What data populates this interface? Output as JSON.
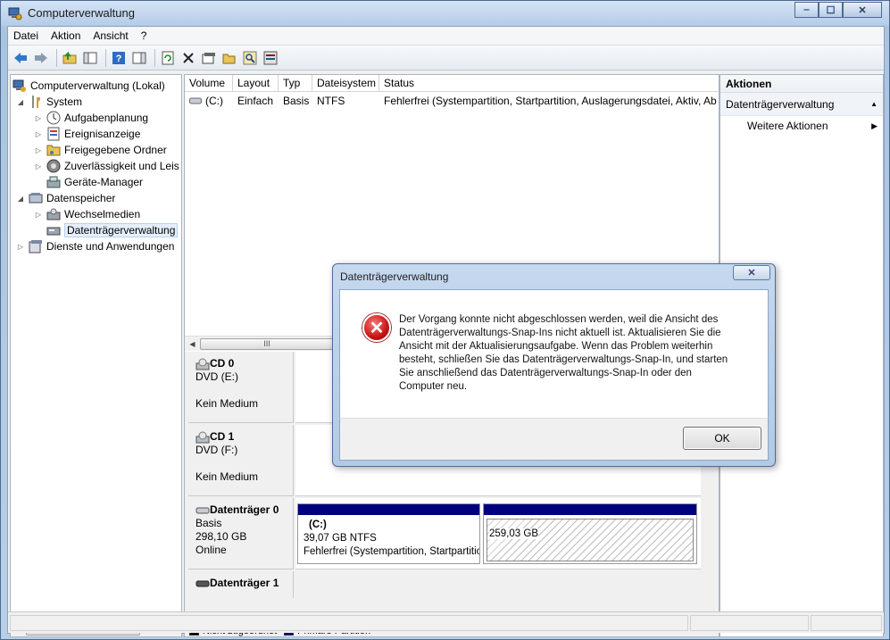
{
  "window": {
    "title": "Computerverwaltung",
    "minimize": "‒",
    "maximize": "☐",
    "close": "✕"
  },
  "menu": [
    "Datei",
    "Aktion",
    "Ansicht",
    "?"
  ],
  "toolbar": {
    "icons": [
      "back-icon",
      "forward-icon",
      "up-folder-icon",
      "show-tree-icon",
      "help-icon",
      "show-actions-icon",
      "refresh-icon",
      "delete-icon",
      "properties-icon",
      "open-icon",
      "search-icon",
      "settings-icon"
    ]
  },
  "tree": {
    "root": "Computerverwaltung (Lokal)",
    "items": [
      {
        "label": "System",
        "level": 1,
        "expander": "◢"
      },
      {
        "label": "Aufgabenplanung",
        "level": 2,
        "expander": "▷"
      },
      {
        "label": "Ereignisanzeige",
        "level": 2,
        "expander": "▷"
      },
      {
        "label": "Freigegebene Ordner",
        "level": 2,
        "expander": "▷"
      },
      {
        "label": "Zuverlässigkeit und Leis",
        "level": 2,
        "expander": "▷"
      },
      {
        "label": "Geräte-Manager",
        "level": 2,
        "expander": ""
      },
      {
        "label": "Datenspeicher",
        "level": 1,
        "expander": "◢"
      },
      {
        "label": "Wechselmedien",
        "level": 2,
        "expander": "▷"
      },
      {
        "label": "Datenträgerverwaltung",
        "level": 2,
        "expander": ""
      },
      {
        "label": "Dienste und Anwendungen",
        "level": 1,
        "expander": "▷"
      }
    ],
    "scroll_thumb": "III"
  },
  "volumes": {
    "headers": [
      "Volume",
      "Layout",
      "Typ",
      "Dateisystem",
      "Status"
    ],
    "rows": [
      [
        "(C:)",
        "Einfach",
        "Basis",
        "NTFS",
        "Fehlerfrei (Systempartition, Startpartition, Auslagerungsdatei, Aktiv, Ab"
      ]
    ],
    "scroll_thumb": "III"
  },
  "disks": [
    {
      "name": "CD 0",
      "type": "DVD (E:)",
      "line3": "",
      "status": "Kein Medium"
    },
    {
      "name": "CD 1",
      "type": "DVD (F:)",
      "line3": "",
      "status": "Kein Medium"
    },
    {
      "name": "Datenträger 0",
      "type": "Basis",
      "line3": "298,10 GB",
      "status": "Online"
    },
    {
      "name": "Datenträger 1",
      "type": "",
      "line3": "",
      "status": ""
    }
  ],
  "partitions": {
    "c_name": "(C:)",
    "c_size": "39,07 GB NTFS",
    "c_status": "Fehlerfrei (Systempartition, Startpartition",
    "unalloc_size": "259,03 GB"
  },
  "legend": {
    "unallocated": "Nicht zugeordnet",
    "primary": "Primäre Partition",
    "colors": {
      "unallocated": "#000000",
      "primary": "#00007f"
    }
  },
  "actions": {
    "header": "Aktionen",
    "section": "Datenträgerverwaltung",
    "item": "Weitere Aktionen"
  },
  "dialog": {
    "title": "Datenträgerverwaltung",
    "lines": [
      "Der Vorgang konnte nicht abgeschlossen werden, weil die Ansicht des",
      "Datenträgerverwaltungs-Snap-Ins nicht aktuell ist. Aktualisieren Sie die",
      "Ansicht mit der Aktualisierungsaufgabe. Wenn das Problem weiterhin",
      "besteht, schließen Sie das Datenträgerverwaltungs-Snap-In, und starten",
      "Sie anschließend das Datenträgerverwaltungs-Snap-In oder den",
      "Computer neu."
    ],
    "ok": "OK"
  }
}
